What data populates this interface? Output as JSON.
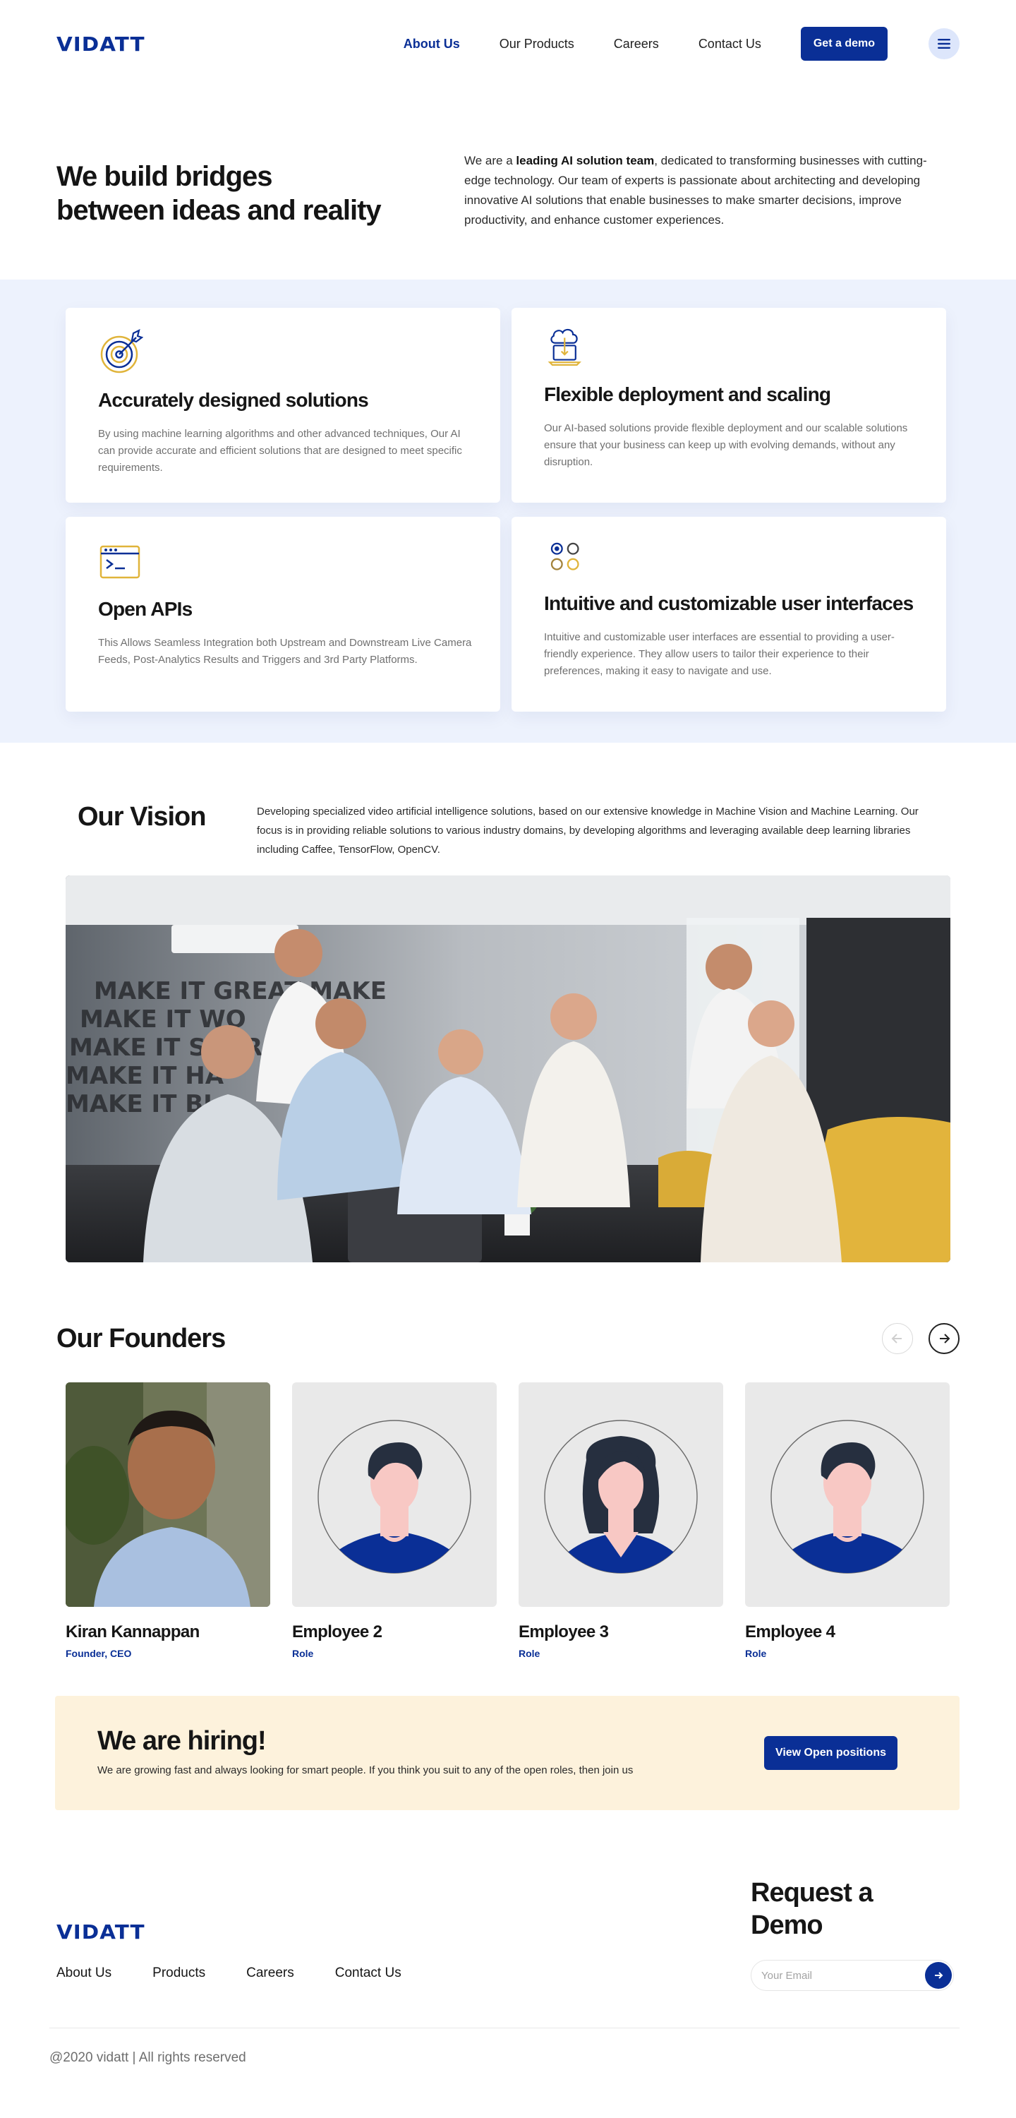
{
  "brand": {
    "logo_text": "VIDATT",
    "accent": "#0a2f96",
    "gold": "#e0b43a"
  },
  "nav": {
    "items": [
      {
        "label": "About Us",
        "active": true
      },
      {
        "label": "Our Products"
      },
      {
        "label": "Careers"
      },
      {
        "label": "Contact Us"
      }
    ],
    "cta_label": "Get a demo",
    "menu_icon": "menu-icon"
  },
  "intro": {
    "title_line1": "We build bridges",
    "title_line2": "between ideas and reality",
    "text_prefix": "We are a ",
    "text_bold": "leading AI solution team",
    "text_suffix": ", dedicated to transforming businesses with cutting-edge technology. Our team of experts is passionate about architecting and developing innovative AI solutions that enable businesses to make smarter decisions, improve productivity, and enhance customer experiences."
  },
  "features": [
    {
      "icon": "target-icon",
      "title": "Accurately designed solutions",
      "desc": "By using machine learning algorithms and other advanced techniques, Our AI can provide accurate and efficient solutions that are designed to meet specific requirements."
    },
    {
      "icon": "cloud-laptop-icon",
      "title": "Flexible deployment and scaling",
      "desc": "Our AI-based solutions provide flexible deployment and our scalable solutions ensure that your business can keep up with evolving demands, without any disruption."
    },
    {
      "icon": "terminal-window-icon",
      "title": "Open APIs",
      "desc": "This Allows Seamless Integration both Upstream and Downstream Live Camera Feeds, Post-Analytics Results and Triggers and 3rd Party Platforms."
    },
    {
      "icon": "ui-options-icon",
      "title": "Intuitive and customizable user interfaces",
      "desc": "Intuitive and customizable user interfaces are essential to providing a user-friendly experience. They allow users to tailor their experience to their preferences, making it easy to navigate and use."
    }
  ],
  "vision": {
    "title": "Our Vision",
    "text": "Developing specialized video artificial intelligence solutions, based on our extensive knowledge in Machine Vision and Machine Learning. Our focus is in providing reliable solutions to various industry domains, by developing algorithms and leveraging available deep learning libraries including Caffee, TensorFlow, OpenCV.",
    "photo_wall_lines": [
      "MAKE IT GREAT  MAKE",
      "MAKE IT WO",
      "MAKE IT SOAR",
      "MAKE IT HA",
      "MAKE IT BI"
    ]
  },
  "founders": {
    "title": "Our Founders",
    "people": [
      {
        "name": "Kiran Kannappan",
        "role": "Founder, CEO",
        "avatar": "photo"
      },
      {
        "name": "Employee 2",
        "role": "Role",
        "avatar": "male"
      },
      {
        "name": "Employee 3",
        "role": "Role",
        "avatar": "female"
      },
      {
        "name": "Employee 4",
        "role": "Role",
        "avatar": "male"
      }
    ]
  },
  "hiring": {
    "title": "We are hiring!",
    "text": "We are growing fast and always looking for smart people. If you think you suit to any of the open roles, then join us",
    "button_label": "View Open positions"
  },
  "footer": {
    "links": [
      "About Us",
      "Products",
      "Careers",
      "Contact Us"
    ],
    "request_title_line1": "Request a",
    "request_title_line2": "Demo",
    "email_placeholder": "Your Email",
    "copyright": "@2020 vidatt | All rights reserved"
  }
}
